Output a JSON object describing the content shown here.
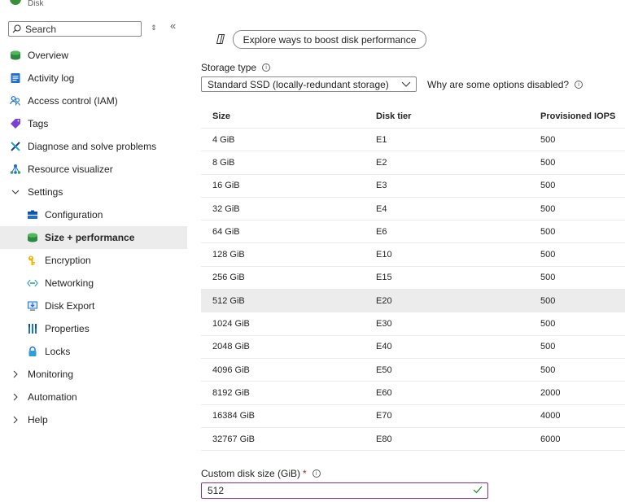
{
  "header": {
    "subtitle": "Disk"
  },
  "search": {
    "placeholder": "Search"
  },
  "sidebar": {
    "items": [
      {
        "label": "Overview"
      },
      {
        "label": "Activity log"
      },
      {
        "label": "Access control (IAM)"
      },
      {
        "label": "Tags"
      },
      {
        "label": "Diagnose and solve problems"
      },
      {
        "label": "Resource visualizer"
      },
      {
        "label": "Settings"
      },
      {
        "label": "Configuration"
      },
      {
        "label": "Size + performance"
      },
      {
        "label": "Encryption"
      },
      {
        "label": "Networking"
      },
      {
        "label": "Disk Export"
      },
      {
        "label": "Properties"
      },
      {
        "label": "Locks"
      },
      {
        "label": "Monitoring"
      },
      {
        "label": "Automation"
      },
      {
        "label": "Help"
      }
    ]
  },
  "main": {
    "boost_label": "Explore ways to boost disk performance",
    "storage_type_label": "Storage type",
    "storage_type_value": "Standard SSD (locally-redundant storage)",
    "why_disabled": "Why are some options disabled?",
    "table": {
      "headers": [
        "Size",
        "Disk tier",
        "Provisioned IOPS"
      ],
      "rows": [
        [
          "4 GiB",
          "E1",
          "500"
        ],
        [
          "8 GiB",
          "E2",
          "500"
        ],
        [
          "16 GiB",
          "E3",
          "500"
        ],
        [
          "32 GiB",
          "E4",
          "500"
        ],
        [
          "64 GiB",
          "E6",
          "500"
        ],
        [
          "128 GiB",
          "E10",
          "500"
        ],
        [
          "256 GiB",
          "E15",
          "500"
        ],
        [
          "512 GiB",
          "E20",
          "500"
        ],
        [
          "1024 GiB",
          "E30",
          "500"
        ],
        [
          "2048 GiB",
          "E40",
          "500"
        ],
        [
          "4096 GiB",
          "E50",
          "500"
        ],
        [
          "8192 GiB",
          "E60",
          "2000"
        ],
        [
          "16384 GiB",
          "E70",
          "4000"
        ],
        [
          "32767 GiB",
          "E80",
          "6000"
        ]
      ]
    },
    "custom_size_label": "Custom disk size (GiB)",
    "required_mark": "*",
    "custom_size_value": "512"
  },
  "colors": {
    "selected_bg": "#ececec",
    "input_focus_border": "#8a2f8a",
    "required": "#a4262c",
    "valid_check": "#107c10"
  }
}
